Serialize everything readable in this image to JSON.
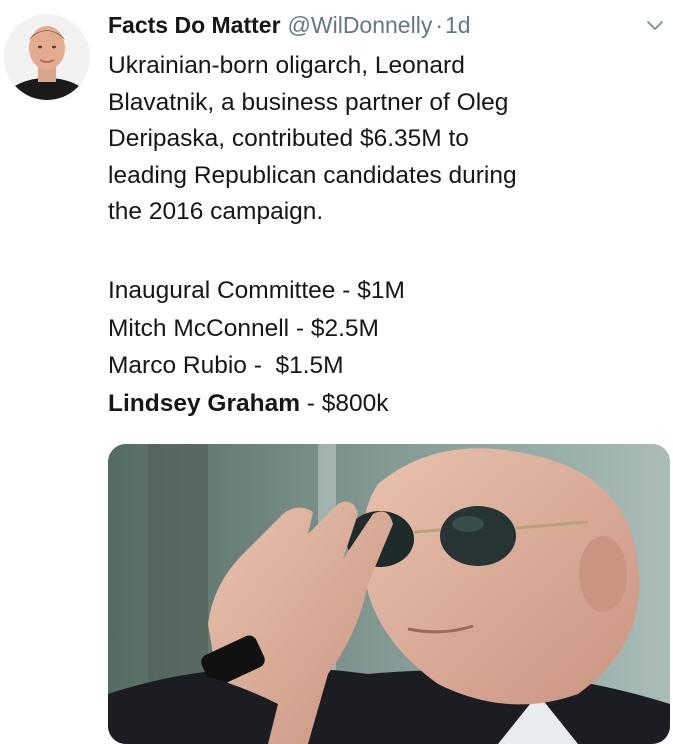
{
  "tweet": {
    "author": {
      "display_name": "Facts Do Matter",
      "handle": "@WilDonnelly",
      "separator": "·",
      "time": "1d"
    },
    "text_lines": [
      "Ukrainian-born oligarch, Leonard",
      "Blavatnik, a business partner of Oleg",
      "Deripaska, contributed $6.35M to",
      "leading Republican candidates during",
      "the 2016 campaign."
    ],
    "donations": [
      {
        "name": "Inaugural Committee",
        "sep": " - ",
        "amount": "$1M"
      },
      {
        "name": "Mitch McConnell",
        "sep": " - ",
        "amount": "$2.5M"
      },
      {
        "name": "Marco Rubio",
        "sep": " -  ",
        "amount": "$1.5M"
      },
      {
        "name": "Lindsey Graham",
        "sep": " - ",
        "amount": "$800k"
      }
    ],
    "icons": {
      "menu": "chevron-down-icon",
      "avatar": "avatar"
    },
    "colors": {
      "text": "#14171a",
      "secondary": "#657786"
    }
  }
}
